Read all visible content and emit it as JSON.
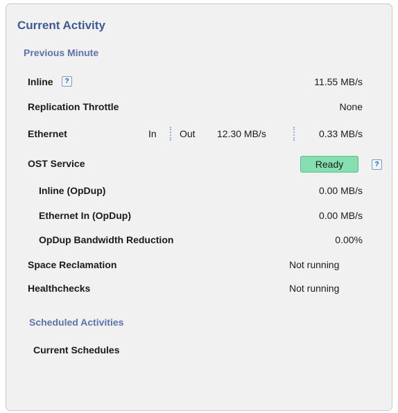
{
  "panel": {
    "title": "Current Activity",
    "previous_minute": {
      "heading": "Previous Minute",
      "inline": {
        "label": "Inline",
        "value": "11.55 MB/s"
      },
      "replication_throttle": {
        "label": "Replication Throttle",
        "value": "None"
      },
      "ethernet": {
        "label": "Ethernet",
        "in_label": "In",
        "out_label": "Out",
        "in_value": "12.30 MB/s",
        "out_value": "0.33 MB/s"
      },
      "ost_service": {
        "label": "OST Service",
        "status": "Ready",
        "status_color": "#86dfb0"
      },
      "inline_opdup": {
        "label": "Inline (OpDup)",
        "value": "0.00 MB/s"
      },
      "ethernet_in_opdup": {
        "label": "Ethernet In (OpDup)",
        "value": "0.00 MB/s"
      },
      "opdup_bandwidth_reduction": {
        "label": "OpDup Bandwidth Reduction",
        "value": "0.00%"
      },
      "space_reclamation": {
        "label": "Space Reclamation",
        "value": "Not running"
      },
      "healthchecks": {
        "label": "Healthchecks",
        "value": "Not running"
      }
    },
    "scheduled_activities": {
      "heading": "Scheduled Activities",
      "current_schedules_label": "Current Schedules"
    },
    "help_glyph": "?",
    "help_icon": "help-icon",
    "accent_color": "#3d5a94"
  }
}
